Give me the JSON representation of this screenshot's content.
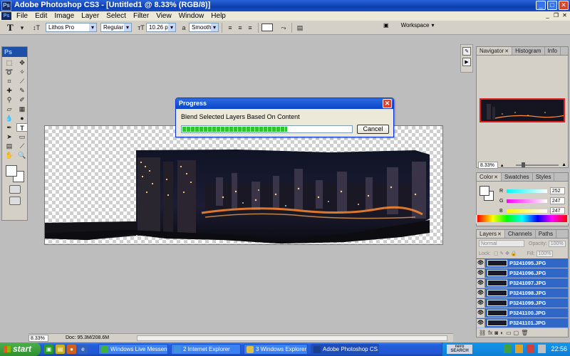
{
  "window": {
    "title": "Adobe Photoshop CS3 - [Untitled1 @ 8.33% (RGB/8)]",
    "app_icon": "Ps",
    "controls": [
      "minimize-icon",
      "maximize-icon",
      "close-icon"
    ]
  },
  "menu": {
    "app_icon": "Ps",
    "items": [
      "File",
      "Edit",
      "Image",
      "Layer",
      "Select",
      "Filter",
      "View",
      "Window",
      "Help"
    ]
  },
  "options": {
    "tool_icon": "T",
    "font_family": "Lithos Pro",
    "font_style": "Regular",
    "font_size": "10.26 pt",
    "antialias_label": "a",
    "antialias": "Smooth",
    "workspace": "Workspace"
  },
  "toolbox": {
    "logo": "Ps",
    "tools": [
      "marquee-tool",
      "move-tool",
      "lasso-tool",
      "magic-wand-tool",
      "crop-tool",
      "slice-tool",
      "healing-brush-tool",
      "brush-tool",
      "clone-stamp-tool",
      "history-brush-tool",
      "eraser-tool",
      "gradient-tool",
      "blur-tool",
      "dodge-tool",
      "pen-tool",
      "type-tool",
      "path-select-tool",
      "shape-tool",
      "notes-tool",
      "eyedropper-tool",
      "hand-tool",
      "zoom-tool"
    ],
    "active_tool": "type-tool"
  },
  "document": {
    "zoom": "8.33%",
    "doc_size": "Doc: 95.3M/208.6M"
  },
  "progress": {
    "title": "Progress",
    "message": "Blend Selected Layers Based On Content",
    "progress": 0.62,
    "cancel_label": "Cancel"
  },
  "navigator": {
    "tabs": [
      "Navigator",
      "Histogram",
      "Info"
    ],
    "zoom": "8.33%"
  },
  "color": {
    "tabs": [
      "Color",
      "Swatches",
      "Styles"
    ],
    "r_label": "R",
    "g_label": "G",
    "b_label": "B",
    "r": "252",
    "g": "247",
    "b": "247"
  },
  "layers": {
    "tabs": [
      "Layers",
      "Channels",
      "Paths"
    ],
    "blend_mode": "Normal",
    "opacity_label": "Opacity:",
    "opacity": "100%",
    "lock_label": "Lock:",
    "fill_label": "Fill:",
    "fill": "100%",
    "items": [
      "P3241095.JPG",
      "P3241096.JPG",
      "P3241097.JPG",
      "P3241098.JPG",
      "P3241099.JPG",
      "P3241100.JPG",
      "P3241101.JPG"
    ]
  },
  "taskbar": {
    "start": "start",
    "buttons": [
      "Windows Live Messen...",
      "2 Internet Explorer",
      "3 Windows Explorer",
      "Adobe Photoshop CS..."
    ],
    "nero_label": "nero SEARCH",
    "clock": "22:56"
  },
  "colors": {
    "title_blue": "#0c3fb0",
    "layer_selected": "#3168c8",
    "progress_green": "#2fc52f",
    "nav_highlight": "#e02020"
  }
}
